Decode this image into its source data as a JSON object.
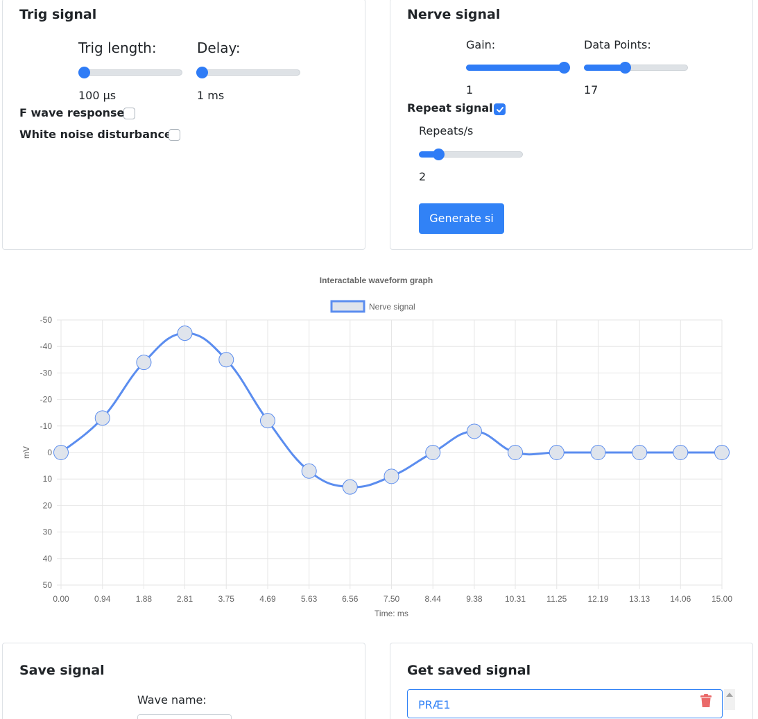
{
  "trig": {
    "title": "Trig signal",
    "trig_length_label": "Trig length:",
    "trig_length_value": "100 µs",
    "trig_length_fraction": 0.0,
    "delay_label": "Delay:",
    "delay_value": "1 ms",
    "delay_fraction": 0.0,
    "f_wave_label": "F wave response",
    "f_wave_checked": false,
    "white_noise_label": "White noise disturbance",
    "white_noise_checked": false
  },
  "nerve": {
    "title": "Nerve signal",
    "gain_label": "Gain:",
    "gain_value": "1",
    "gain_fraction": 1.0,
    "data_points_label": "Data Points:",
    "data_points_value": "17",
    "data_points_fraction": 0.38,
    "repeat_label": "Repeat signal",
    "repeat_checked": true,
    "repeats_label": "Repeats/s",
    "repeats_value": "2",
    "repeats_fraction": 0.15,
    "generate_button": "Generate si"
  },
  "save": {
    "title": "Save signal",
    "wave_name_label": "Wave name:",
    "wave_name_value": ""
  },
  "saved": {
    "title": "Get saved signal",
    "items": [
      "PRÆ1"
    ]
  },
  "colors": {
    "accent": "#2f7cf6",
    "line": "#5b8def",
    "point_fill": "#dfe4ec",
    "grid": "#e6e6e6",
    "delete_icon": "#ea6a6a"
  },
  "icons": {
    "delete": "trash-icon",
    "checkbox_tick": "check-icon"
  },
  "chart_data": {
    "type": "line",
    "title": "Interactable waveform graph",
    "xlabel": "Time: ms",
    "ylabel": "mV",
    "x_ticks": [
      "0.00",
      "0.94",
      "1.88",
      "2.81",
      "3.75",
      "4.69",
      "5.63",
      "6.56",
      "7.50",
      "8.44",
      "9.38",
      "10.31",
      "11.25",
      "12.19",
      "13.13",
      "14.06",
      "15.00"
    ],
    "y_ticks": [
      "-50",
      "-40",
      "-30",
      "-20",
      "-10",
      "0",
      "10",
      "20",
      "30",
      "40",
      "50"
    ],
    "ylim": [
      -50,
      50
    ],
    "y_reversed": true,
    "grid": true,
    "legend": "top-center",
    "series": [
      {
        "name": "Nerve signal",
        "x": [
          0.0,
          0.94,
          1.88,
          2.81,
          3.75,
          4.69,
          5.63,
          6.56,
          7.5,
          8.44,
          9.38,
          10.31,
          11.25,
          12.19,
          13.13,
          14.06,
          15.0
        ],
        "y": [
          0,
          -13,
          -34,
          -45,
          -35,
          -12,
          7,
          13,
          9,
          0,
          -8,
          0,
          0,
          0,
          0,
          0,
          0
        ]
      }
    ]
  }
}
